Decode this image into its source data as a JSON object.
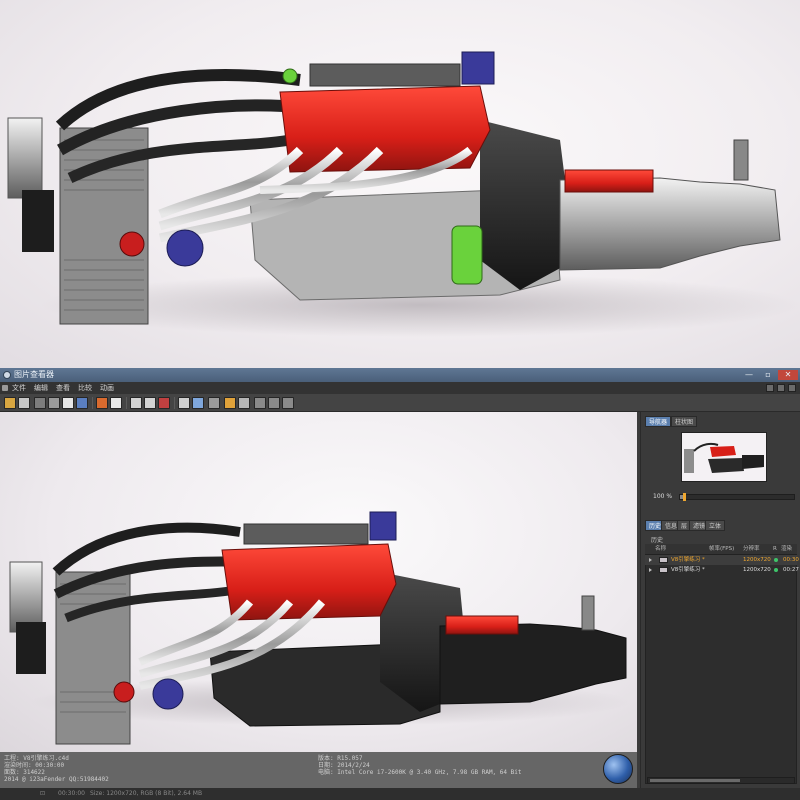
{
  "window": {
    "title": "图片查看器",
    "controls": [
      "—",
      "▫",
      "✕"
    ]
  },
  "menu": {
    "items": [
      "文件",
      "编辑",
      "查看",
      "比较",
      "动画"
    ]
  },
  "toolbar": {
    "icons": [
      "open-icon",
      "save-icon",
      "copy-icon",
      "stereo-icon",
      "region-render-icon",
      "info-icon",
      "export-icon",
      "display-mode-icon",
      "grid-icon",
      "filter-icon",
      "channel-icon",
      "alpha-icon",
      "warning-icon",
      "histogram-icon",
      "compare-icon",
      "lock-icon"
    ],
    "accent": "#d96a2e"
  },
  "info": {
    "left": [
      "工程: V8引擎练习.c4d",
      "渲染时间: 00:30:00",
      "面数: 314622",
      "2014 @ i23aFender QQ:51984402"
    ],
    "right": [
      "版本: R15.057",
      "日期: 2014/2/24",
      "电脑: Intel Core i7-2600K @ 3.40 GHz, 7.98 GB RAM, 64 Bit"
    ]
  },
  "navigator": {
    "tabs": [
      "导航器",
      "柱状图"
    ],
    "zoom_label": "100 %",
    "zoom_fraction": 0.03
  },
  "history": {
    "tabs": [
      "历史",
      "信息",
      "层",
      "滤镜",
      "立体"
    ],
    "section_title": "历史",
    "columns": [
      "名称",
      "帧率(FPS)",
      "分辨率",
      "R",
      "渲染时"
    ],
    "rows": [
      {
        "name": "V8引擎练习 *",
        "resolution": "1200x720",
        "time": "00:30",
        "highlight": true
      },
      {
        "name": "V8引擎练习 *",
        "resolution": "1200x720",
        "time": "00:27",
        "highlight": false
      }
    ]
  },
  "status": {
    "items": [
      "⊡",
      "00:30:00",
      "Size: 1200x720, RGB (8 Bit), 2.64 MB"
    ]
  },
  "colors": {
    "highlight_text": "#f0a830",
    "status_green": "#3ec46a",
    "tab_active": "#5b7fae"
  }
}
